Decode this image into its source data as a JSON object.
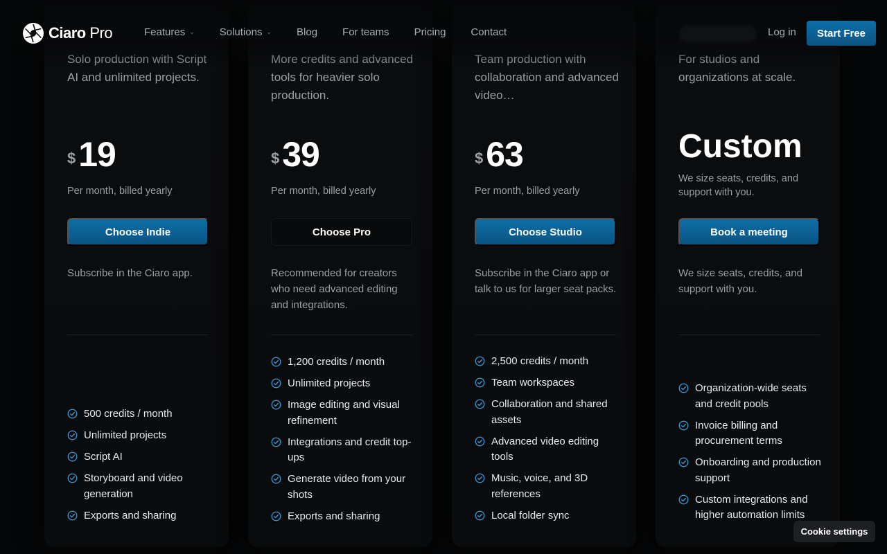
{
  "header": {
    "logo_brand": "Ciaro",
    "logo_suffix": "Pro",
    "nav": [
      {
        "label": "Features",
        "dropdown": true
      },
      {
        "label": "Solutions",
        "dropdown": true
      },
      {
        "label": "Blog",
        "dropdown": false
      },
      {
        "label": "For teams",
        "dropdown": false
      },
      {
        "label": "Pricing",
        "dropdown": false
      },
      {
        "label": "Contact",
        "dropdown": false
      }
    ],
    "login_label": "Log in",
    "start_label": "Start Free"
  },
  "plans": [
    {
      "description": "Solo production with Script AI and unlimited projects.",
      "currency": "$",
      "price": "19",
      "billing": "Per month, billed yearly",
      "cta": "Choose Indie",
      "note": "Subscribe in the Ciaro app.",
      "features": [
        "500 credits / month",
        "Unlimited projects",
        "Script AI",
        "Storyboard and video generation",
        "Exports and sharing"
      ]
    },
    {
      "description": "More credits and advanced tools for heavier solo production.",
      "currency": "$",
      "price": "39",
      "billing": "Per month, billed yearly",
      "cta": "Choose Pro",
      "note": "Recommended for creators who need advanced editing and integrations.",
      "features": [
        "1,200 credits / month",
        "Unlimited projects",
        "Image editing and visual refinement",
        "Integrations and credit top-ups",
        "Generate video from your shots",
        "Exports and sharing"
      ]
    },
    {
      "description": "Team production with collaboration and advanced video…",
      "currency": "$",
      "price": "63",
      "billing": "Per month, billed yearly",
      "cta": "Choose Studio",
      "note": "Subscribe in the Ciaro app or talk to us for larger seat packs.",
      "features": [
        "2,500 credits / month",
        "Team workspaces",
        "Collaboration and shared assets",
        "Advanced video editing tools",
        "Music, voice, and 3D references",
        "Local folder sync"
      ]
    },
    {
      "description": "For studios and organizations at scale.",
      "price_label": "Custom",
      "billing": "We size seats, credits, and support with you.",
      "cta": "Book a meeting",
      "note": "We size seats, credits, and support with you.",
      "features": [
        "Organization-wide seats and credit pools",
        "Invoice billing and procurement terms",
        "Onboarding and production support",
        "Custom integrations and higher automation limits"
      ]
    }
  ],
  "cookie_label": "Cookie settings",
  "colors": {
    "accent": "#0e6ea7",
    "check": "#3d9ad6",
    "background": "#050607"
  }
}
